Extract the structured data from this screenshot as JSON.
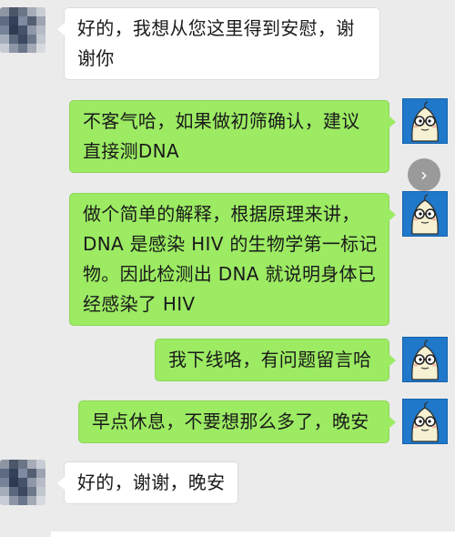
{
  "messages": [
    {
      "sender": "contact",
      "text": "好的，我想从您这里得到安慰，谢谢你"
    },
    {
      "sender": "self",
      "text": "不客气哈，如果做初筛确认，建议直接测DNA"
    },
    {
      "sender": "self",
      "text": "做个简单的解释，根据原理来讲，DNA 是感染 HIV 的生物学第一标记物。因此检测出 DNA 就说明身体已经感染了 HIV"
    },
    {
      "sender": "self",
      "text": "我下线咯，有问题留言哈"
    },
    {
      "sender": "self",
      "text": "早点休息，不要想那么多了，晚安"
    },
    {
      "sender": "contact",
      "text": "好的，谢谢，晚安"
    }
  ],
  "icons": {
    "contact_avatar": "pixelated-avatar",
    "self_avatar": "cartoon-ghost-glasses-avatar",
    "forward": "chevron-right-icon"
  },
  "colors": {
    "background": "#ebebeb",
    "incoming_bubble": "#ffffff",
    "outgoing_bubble": "#9ceb63",
    "avatar_blue": "#1f78c9"
  }
}
